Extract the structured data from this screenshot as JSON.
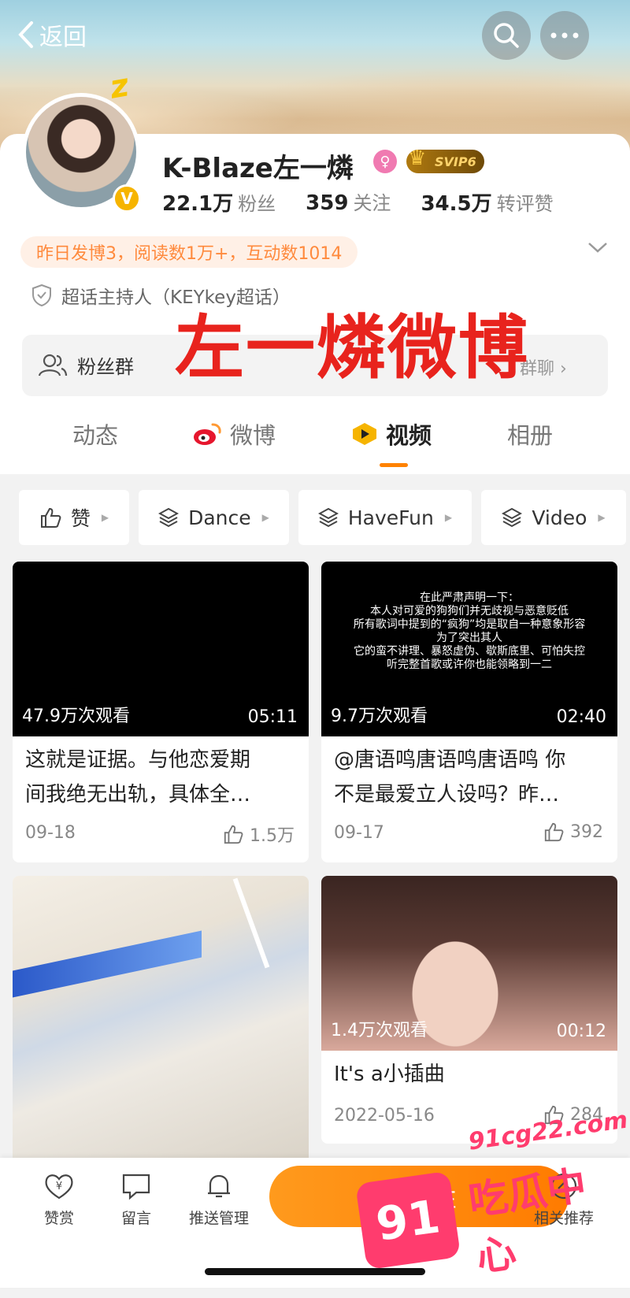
{
  "nav": {
    "back_label": "返回"
  },
  "profile": {
    "name": "K-Blaze左一燐",
    "vip_label": "SVIP6",
    "verify_mark": "V",
    "stats": [
      {
        "value": "22.1万",
        "label": "粉丝"
      },
      {
        "value": "359",
        "label": "关注"
      },
      {
        "value": "34.5万",
        "label": "转评赞"
      }
    ],
    "activity": "昨日发博3，阅读数1万+，互动数1014",
    "host_label": "超话主持人（KEYkey超话）",
    "fan_group_label": "粉丝群",
    "fan_group_chat": "群聊 ›"
  },
  "overlay_title": "左一燐微博",
  "tabs": [
    {
      "label": "动态"
    },
    {
      "label": "微博"
    },
    {
      "label": "视频"
    },
    {
      "label": "相册"
    }
  ],
  "filters": [
    {
      "label": "赞"
    },
    {
      "label": "Dance"
    },
    {
      "label": "HaveFun"
    },
    {
      "label": "Video"
    }
  ],
  "videos": [
    {
      "views": "47.9万次观看",
      "duration": "05:11",
      "title_line1": "这就是证据。与他恋爱期",
      "title_line2": "间我绝无出轨，具体全…",
      "date": "09-18",
      "likes": "1.5万"
    },
    {
      "views": "9.7万次观看",
      "duration": "02:40",
      "title_line1": "@唐语鸣唐语鸣唐语鸣 你",
      "title_line2": "不是最爱立人设吗？昨…",
      "date": "09-17",
      "likes": "392",
      "notice": [
        "在此严肃声明一下：",
        "本人对可爱的狗狗们并无歧视与恶意贬低",
        "所有歌词中提到的“疯狗”均是取自一种意象形容",
        "为了突出其人",
        "它的蛮不讲理、暴怒虚伪、歇斯底里、可怕失控",
        "听完整首歌或许你也能领略到一二"
      ]
    },
    {
      "views": "",
      "duration": "",
      "title_line1": "",
      "title_line2": "",
      "date": "",
      "likes": ""
    },
    {
      "views": "1.4万次观看",
      "duration": "00:12",
      "title_line1": "It's a小插曲",
      "title_line2": "",
      "date": "2022-05-16",
      "likes": "284"
    }
  ],
  "bottom_bar": {
    "reward": "赞赏",
    "message": "留言",
    "push": "推送管理",
    "follow": "+ 关注",
    "related": "相关推荐"
  },
  "watermark": {
    "number": "91",
    "url": "91cg22.com",
    "text": "吃瓜中心"
  },
  "colors": {
    "accent": "#ff8200",
    "overlay_red": "#e8231d",
    "watermark_pink": "#ff3c6e"
  }
}
